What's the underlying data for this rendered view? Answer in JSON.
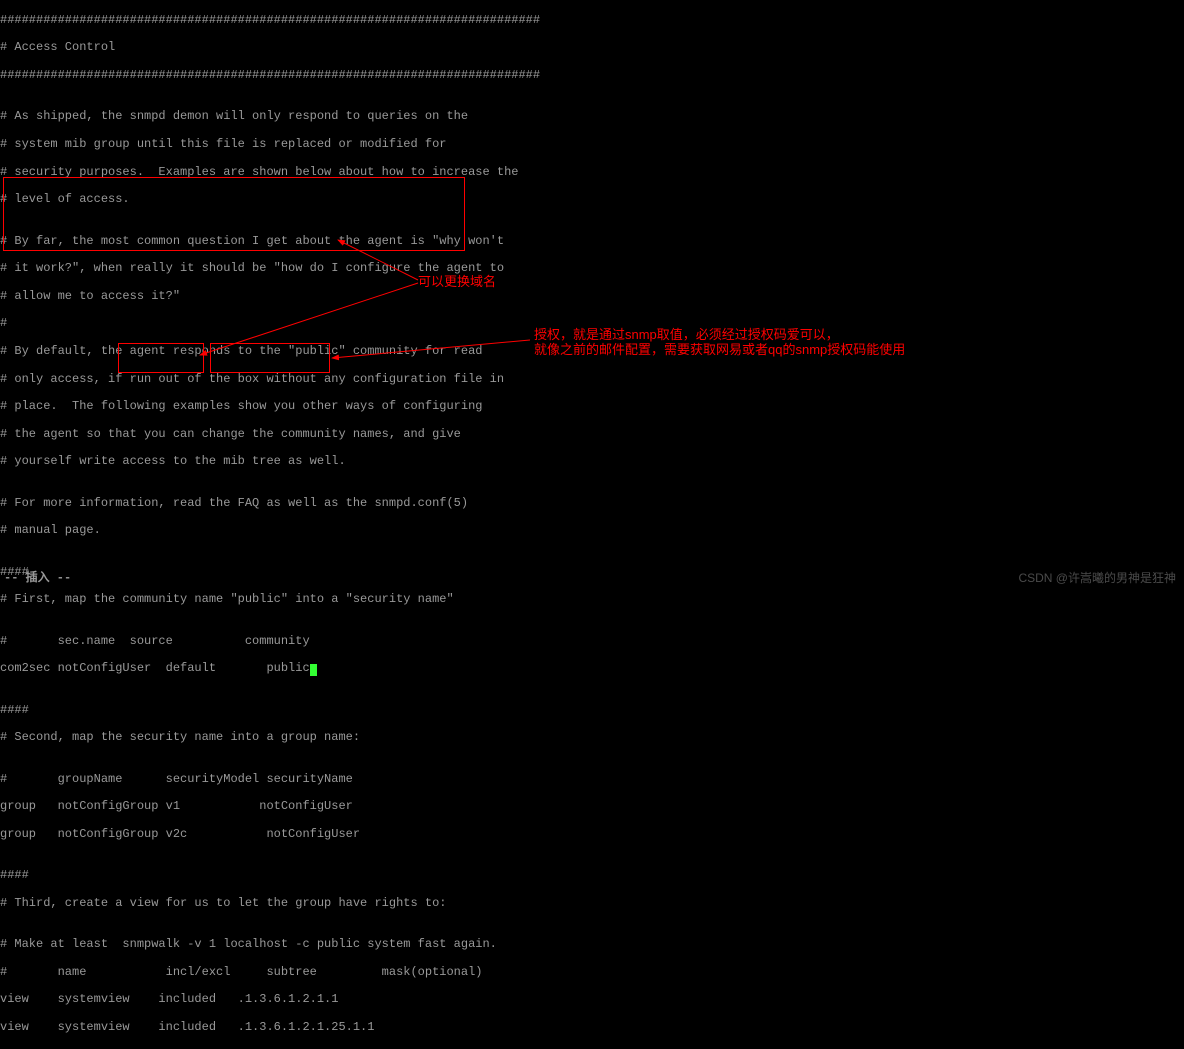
{
  "lines": {
    "l0": "###########################################################################",
    "l1": "# Access Control",
    "l2": "###########################################################################",
    "l3": "",
    "l4": "# As shipped, the snmpd demon will only respond to queries on the",
    "l5": "# system mib group until this file is replaced or modified for",
    "l6": "# security purposes.  Examples are shown below about how to increase the",
    "l7": "# level of access.",
    "l8": "",
    "l9": "# By far, the most common question I get about the agent is \"why won't",
    "l10": "# it work?\", when really it should be \"how do I configure the agent to",
    "l11": "# allow me to access it?\"",
    "l12": "#",
    "l13": "# By default, the agent responds to the \"public\" community for read",
    "l14": "# only access, if run out of the box without any configuration file in",
    "l15": "# place.  The following examples show you other ways of configuring",
    "l16": "# the agent so that you can change the community names, and give",
    "l17": "# yourself write access to the mib tree as well.",
    "l18": "",
    "l19": "# For more information, read the FAQ as well as the snmpd.conf(5)",
    "l20": "# manual page.",
    "l21": "",
    "l22": "####",
    "l23": "# First, map the community name \"public\" into a \"security name\"",
    "l24": "",
    "l25": "#       sec.name  source          community",
    "l26": "com2sec notConfigUser  default       public",
    "l27": "",
    "l28": "####",
    "l29": "# Second, map the security name into a group name:",
    "l30": "",
    "l31": "#       groupName      securityModel securityName",
    "l32": "group   notConfigGroup v1           notConfigUser",
    "l33": "group   notConfigGroup v2c           notConfigUser",
    "l34": "",
    "l35": "####",
    "l36": "# Third, create a view for us to let the group have rights to:",
    "l37": "",
    "l38": "# Make at least  snmpwalk -v 1 localhost -c public system fast again.",
    "l39": "#       name           incl/excl     subtree         mask(optional)",
    "l40": "view    systemview    included   .1.3.6.1.2.1.1",
    "l41": "view    systemview    included   .1.3.6.1.2.1.25.1.1"
  },
  "annotations": {
    "domain_note": "可以更换域名",
    "auth_note_line1": "授权，就是通过snmp取值，必须经过授权码爱可以，",
    "auth_note_line2": "就像之前的邮件配置，需要获取网易或者qq的snmp授权码能使用"
  },
  "status": "-- 插入 --",
  "watermark": "CSDN @许嵩曦的男神是狂神"
}
